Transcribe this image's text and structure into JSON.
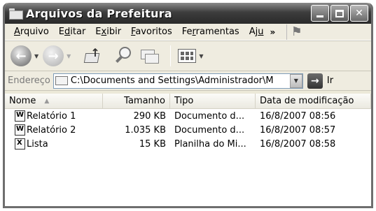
{
  "window": {
    "title": "Arquivos da Prefeitura",
    "icon": "folder-icon",
    "controls": [
      "minimize-icon",
      "maximize-icon",
      "close-icon"
    ]
  },
  "menu": {
    "items": [
      {
        "label": "Arquivo",
        "access_key": "A"
      },
      {
        "label": "Editar",
        "access_key": "d"
      },
      {
        "label": "Exibir",
        "access_key": "x"
      },
      {
        "label": "Favoritos",
        "access_key": "F"
      },
      {
        "label": "Ferramentas",
        "access_key": "r"
      },
      {
        "label": "Aju",
        "access_key": "u"
      }
    ],
    "overflow_label": "»"
  },
  "toolbar": {
    "back_icon": "back-arrow-icon",
    "forward_icon": "forward-arrow-icon",
    "up_icon": "up-folder-icon",
    "search_icon": "search-icon",
    "folders_icon": "folders-icon",
    "views_icon": "views-icon"
  },
  "address": {
    "label": "Endereço",
    "value": "C:\\Documents and Settings\\Administrador\\M",
    "go_label": "Ir"
  },
  "list": {
    "columns": [
      "Nome",
      "Tamanho",
      "Tipo",
      "Data de modificação"
    ],
    "sorted_column": "Nome",
    "sort_direction": "ascending",
    "files": [
      {
        "name": "Relatório 1",
        "size": "290 KB",
        "type": "Documento d...",
        "modified": "16/8/2007 08:56",
        "icon": "word-document-icon"
      },
      {
        "name": "Relatório 2",
        "size": "1.035 KB",
        "type": "Documento d...",
        "modified": "16/8/2007 08:57",
        "icon": "word-document-icon"
      },
      {
        "name": "Lista",
        "size": "15 KB",
        "type": "Planilha do Mi...",
        "modified": "16/8/2007 08:58",
        "icon": "excel-spreadsheet-icon"
      }
    ]
  }
}
